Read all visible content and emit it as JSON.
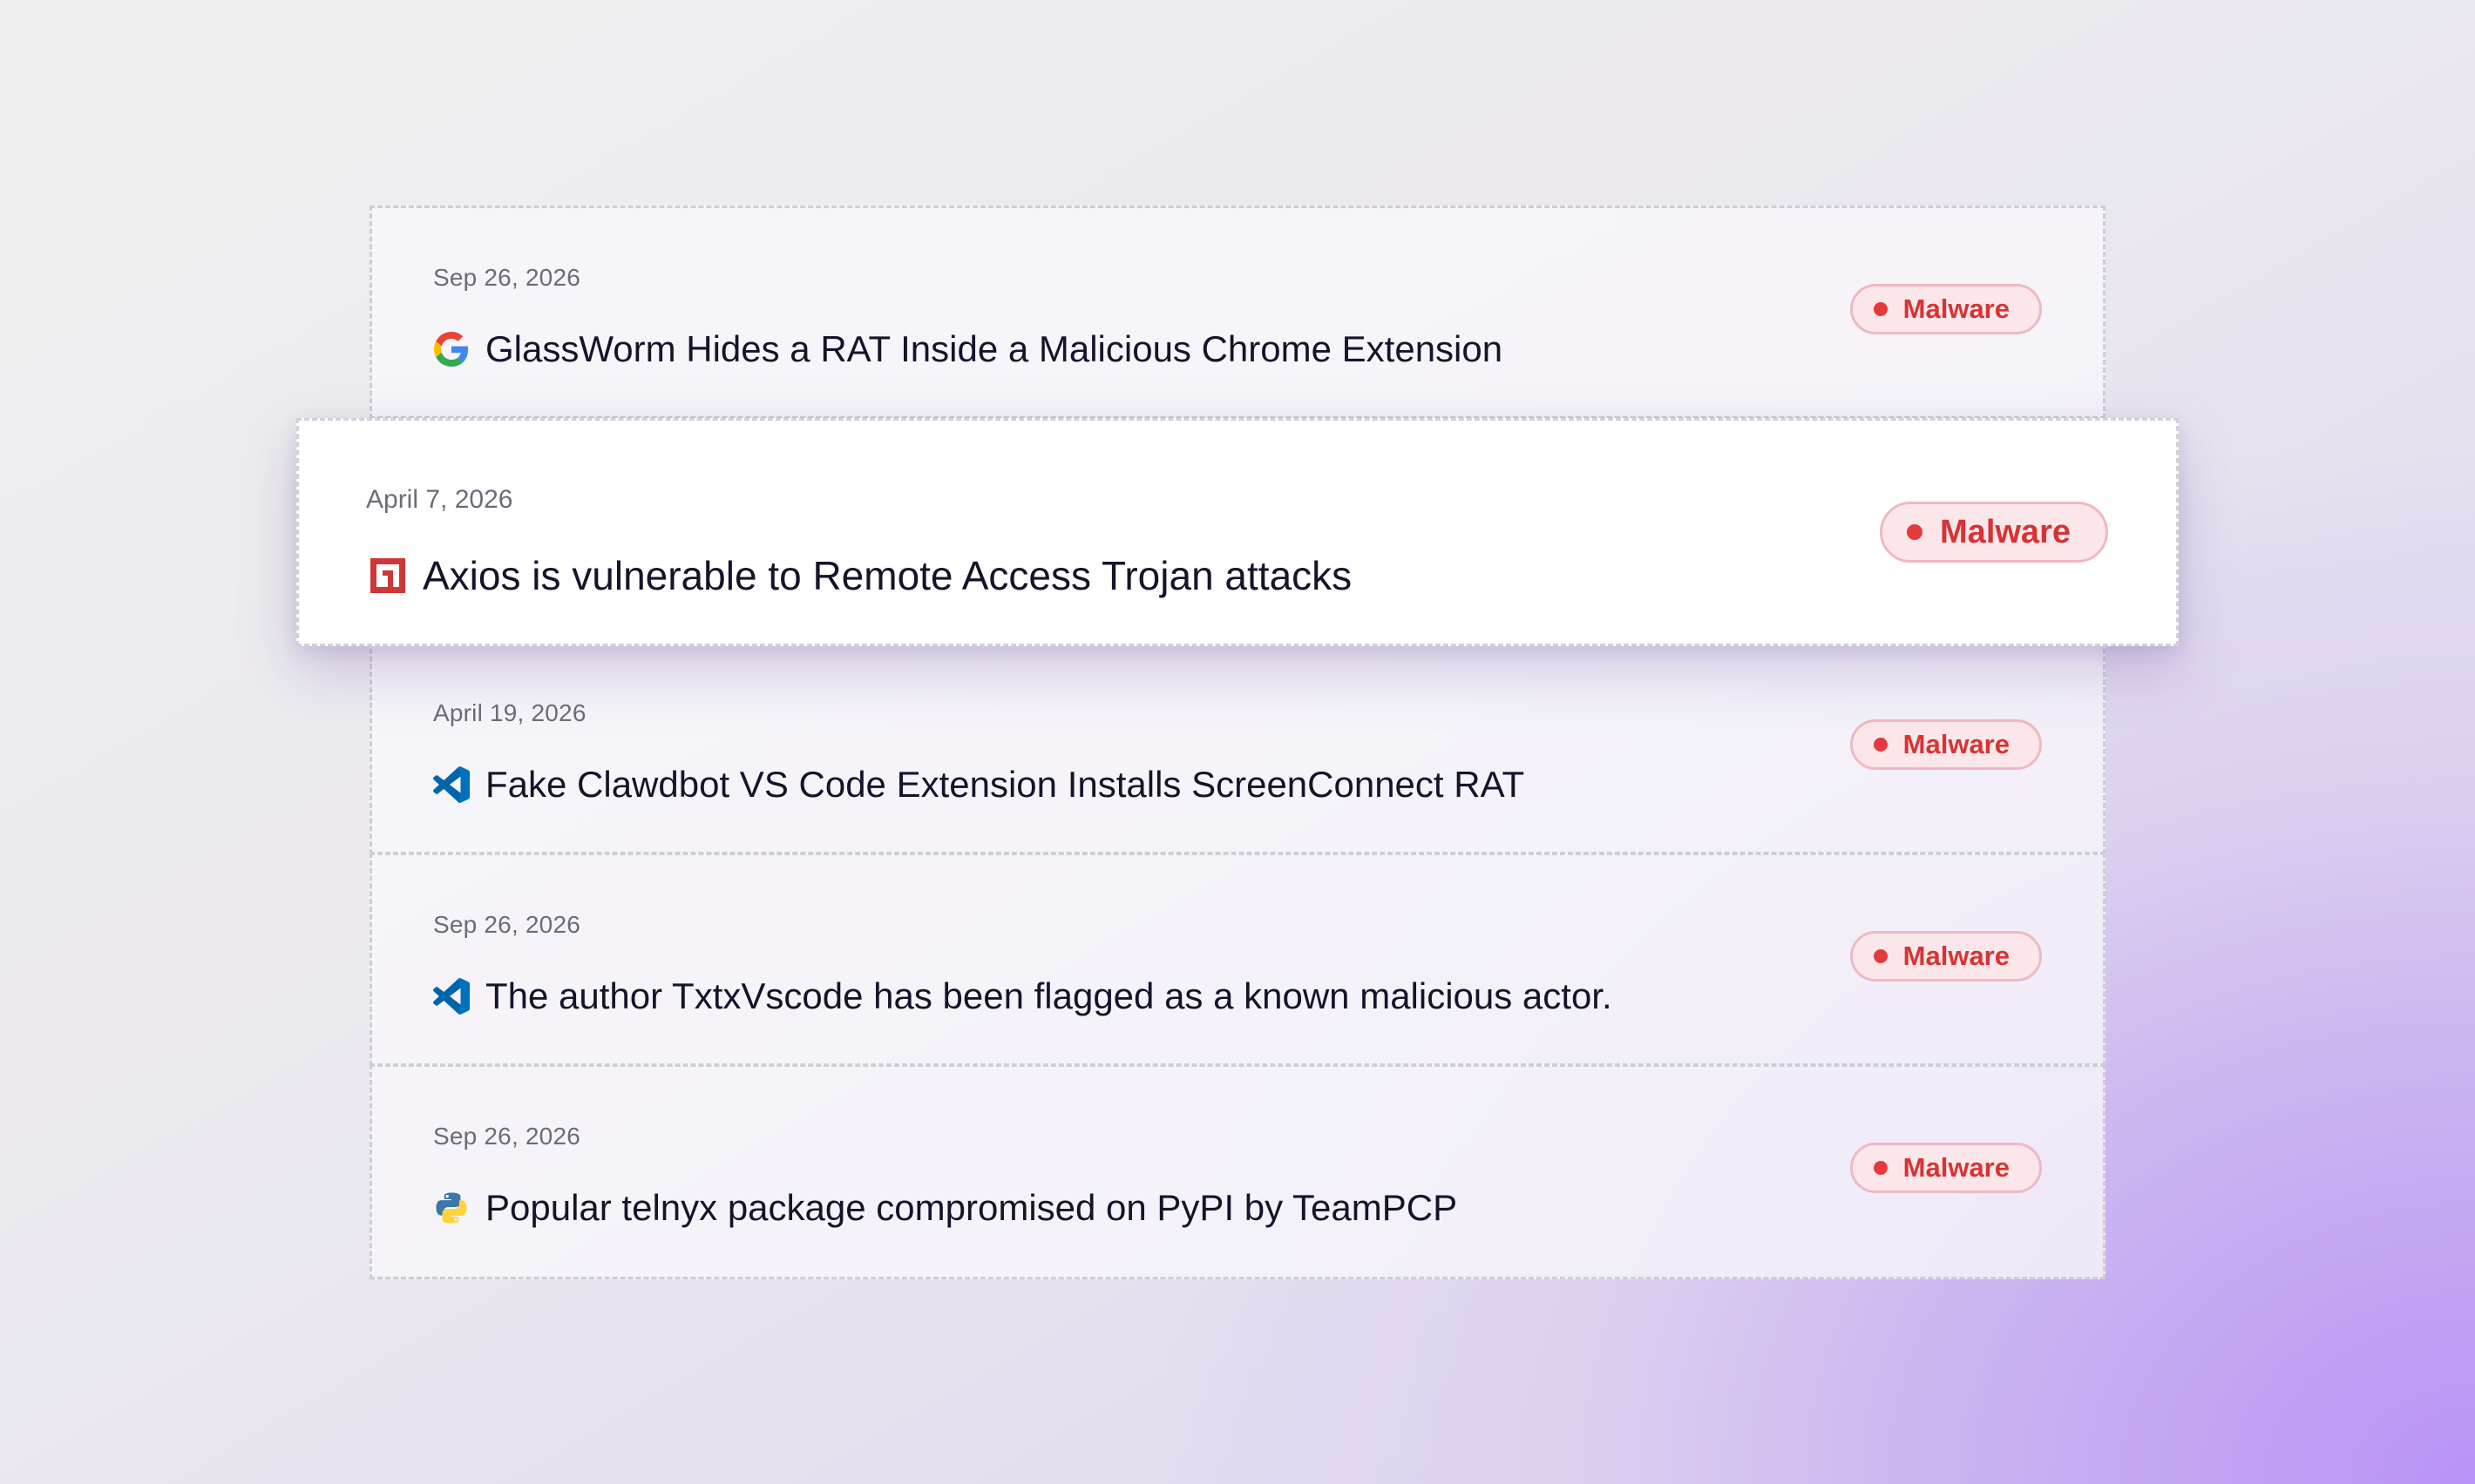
{
  "items": [
    {
      "date": "Sep 26, 2026",
      "title": "GlassWorm Hides a RAT Inside a Malicious Chrome Extension",
      "icon": "google-icon",
      "badge": "Malware"
    },
    {
      "date": "April 7, 2026",
      "title": "Axios is vulnerable to Remote Access Trojan attacks",
      "icon": "npm-icon",
      "badge": "Malware"
    },
    {
      "date": "April 19, 2026",
      "title": "Fake Clawdbot VS Code Extension Installs ScreenConnect RAT",
      "icon": "vscode-icon",
      "badge": "Malware"
    },
    {
      "date": "Sep 26, 2026",
      "title": "The author TxtxVscode has been flagged as a known malicious actor.",
      "icon": "vscode-icon",
      "badge": "Malware"
    },
    {
      "date": "Sep 26, 2026",
      "title": "Popular telnyx package compromised on PyPI by TeamPCP",
      "icon": "python-icon",
      "badge": "Malware"
    }
  ],
  "colors": {
    "badge_text": "#d63434",
    "badge_bg": "#fbe7ea",
    "badge_border": "#eeb9c3",
    "dot": "#e5393b",
    "npm_red": "#cb3837",
    "vscode_blue": "#0e7ad3"
  }
}
